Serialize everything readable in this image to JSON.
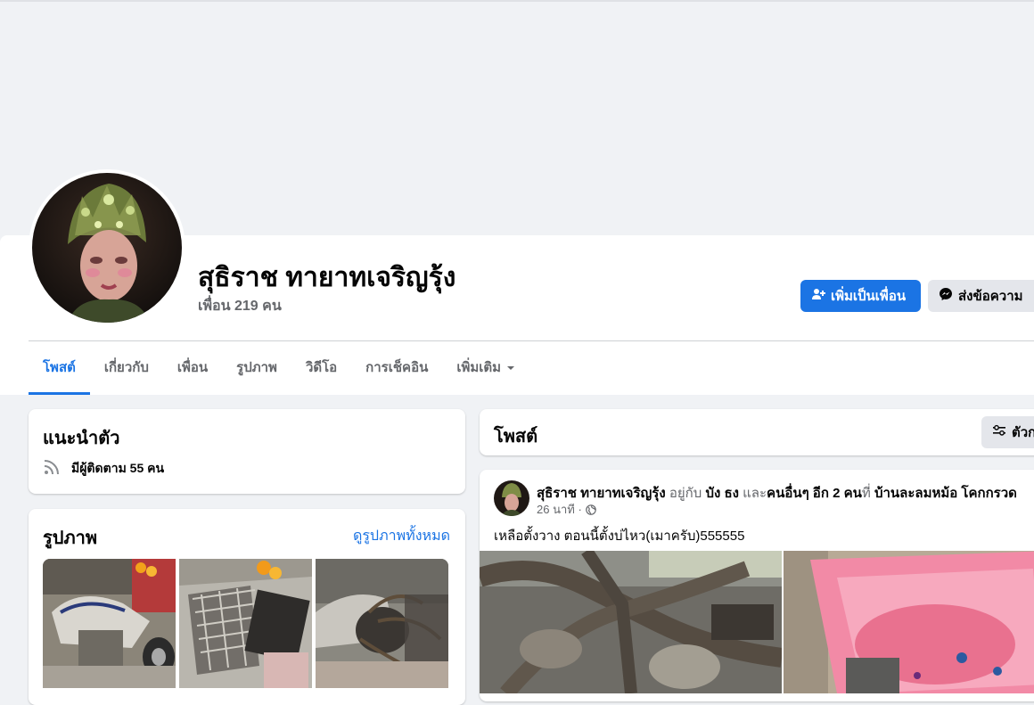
{
  "profile": {
    "name": "สุธิราช ทายาทเจริญรุ้ง",
    "friends": "เพื่อน 219 คน"
  },
  "actions": {
    "add_friend": "เพิ่มเป็นเพื่อน",
    "message": "ส่งข้อความ"
  },
  "tabs": [
    {
      "label": "โพสต์"
    },
    {
      "label": "เกี่ยวกับ"
    },
    {
      "label": "เพื่อน"
    },
    {
      "label": "รูปภาพ"
    },
    {
      "label": "วิดีโอ"
    },
    {
      "label": "การเช็คอิน"
    },
    {
      "label": "เพิ่มเติม"
    }
  ],
  "intro": {
    "title": "แนะนำตัว",
    "followers": "มีผู้ติดตาม 55 คน"
  },
  "photos": {
    "title": "รูปภาพ",
    "see_all": "ดูรูปภาพทั้งหมด"
  },
  "posts": {
    "title": "โพสต์",
    "filter_label": "ตัวก"
  },
  "post": {
    "author": "สุธิราช ทายาทเจริญรุ้ง",
    "with_text": "อยู่กับ",
    "tagged": "บัง ธง",
    "and_text": "และ",
    "others": "คนอื่นๆ อีก 2 คน",
    "at_text": "ที่",
    "place": "บ้านละลมหม้อ โคกกรวด",
    "time": "26 นาที ·",
    "text": "เหลือตั้งวาง ตอนนี้ตั้งบ่ไหว(เมาครับ)555555"
  },
  "colors": {
    "accent": "#1b74e4",
    "background": "#f0f2f5",
    "secondary_button": "#e4e6eb",
    "muted_text": "#65676b"
  },
  "icons": {
    "add_friend": "person-plus-icon",
    "message": "messenger-icon",
    "followers": "rss-icon",
    "filter": "sliders-icon",
    "privacy": "globe-icon",
    "more": "caret-down-icon"
  }
}
